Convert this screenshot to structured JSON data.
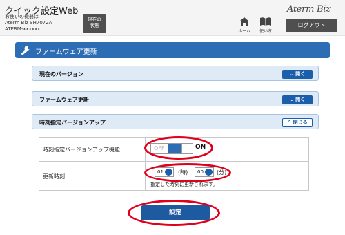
{
  "header": {
    "title": "クイック設定Web",
    "device_lines": [
      "お使いの機器は",
      "Aterm Biz SH7072A",
      "ATERM-xxxxxx"
    ],
    "status_button_lines": [
      "現在の",
      "状態"
    ],
    "brand": "Aterm Biz",
    "nav": {
      "home_label": "ホーム",
      "help_label": "使い方"
    },
    "logout_label": "ログアウト"
  },
  "section": {
    "title": "ファームウェア更新",
    "panels": [
      {
        "label": "現在のバージョン",
        "button": "開く"
      },
      {
        "label": "ファームウェア更新",
        "button": "開く"
      },
      {
        "label": "時刻指定バージョンアップ",
        "button": "閉じる"
      }
    ]
  },
  "settings": {
    "feature": {
      "label": "時刻指定バージョンアップ機能",
      "off_label": "OFF",
      "on_label": "ON",
      "state": "ON"
    },
    "update_time": {
      "label": "更新時刻",
      "hour_value": "01",
      "hour_unit": "(時)",
      "minute_value": "00",
      "minute_unit": "(分)",
      "note": "指定した時刻に更新されます。"
    }
  },
  "submit_label": "設定",
  "colors": {
    "accent": "#2d6db4",
    "panel_bg": "#dfeaf7",
    "highlight": "#e0001b"
  }
}
